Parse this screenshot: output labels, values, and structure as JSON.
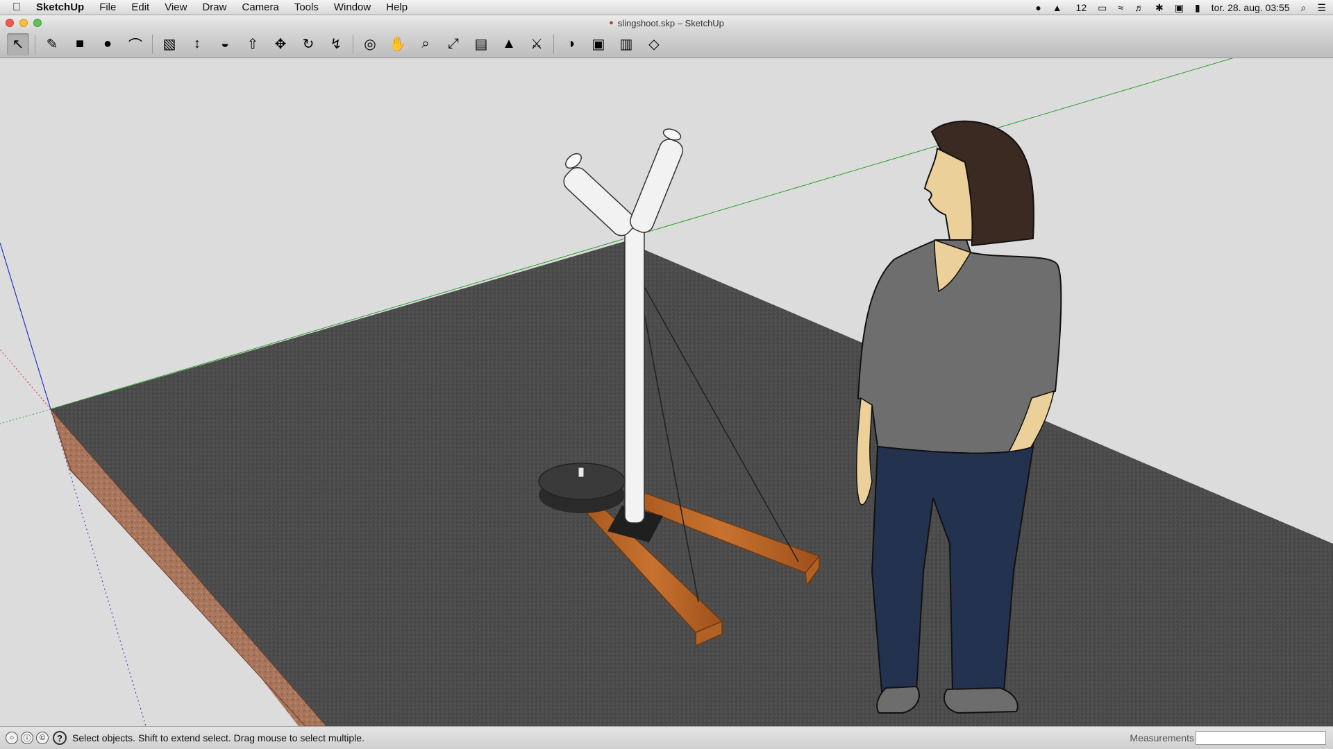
{
  "menubar": {
    "app_name": "SketchUp",
    "items": [
      "File",
      "Edit",
      "View",
      "Draw",
      "Camera",
      "Tools",
      "Window",
      "Help"
    ],
    "right": {
      "notify_count": "12",
      "datetime": "tor. 28. aug.  03:55"
    }
  },
  "window": {
    "title": "slingshoot.skp – SketchUp"
  },
  "toolbar": {
    "tools": [
      {
        "name": "select-tool",
        "icon": "↖"
      },
      {
        "name": "pencil-tool",
        "icon": "✎"
      },
      {
        "name": "rectangle-tool",
        "icon": "■"
      },
      {
        "name": "circle-tool",
        "icon": "●"
      },
      {
        "name": "arc-tool",
        "icon": "⌒"
      },
      {
        "name": "eraser-tool",
        "icon": "▧"
      },
      {
        "name": "tape-measure-tool",
        "icon": "↕"
      },
      {
        "name": "paint-bucket-tool",
        "icon": "◒"
      },
      {
        "name": "push-pull-tool",
        "icon": "⇧"
      },
      {
        "name": "move-tool",
        "icon": "✥"
      },
      {
        "name": "rotate-tool",
        "icon": "↻"
      },
      {
        "name": "follow-me-tool",
        "icon": "↯"
      },
      {
        "name": "orbit-tool",
        "icon": "◎"
      },
      {
        "name": "pan-tool",
        "icon": "✋"
      },
      {
        "name": "zoom-tool",
        "icon": "⌕"
      },
      {
        "name": "zoom-extents-tool",
        "icon": "⤢"
      },
      {
        "name": "previous-view-tool",
        "icon": "▤"
      },
      {
        "name": "position-camera-tool",
        "icon": "▲"
      },
      {
        "name": "walk-tool",
        "icon": "⚔"
      },
      {
        "name": "get-models-tool",
        "icon": "◑"
      },
      {
        "name": "share-model-tool",
        "icon": "▣"
      },
      {
        "name": "extension-warehouse-tool",
        "icon": "▥"
      },
      {
        "name": "layout-tool",
        "icon": "◇"
      }
    ]
  },
  "statusbar": {
    "status_text": "Select objects. Shift to extend select. Drag mouse to select multiple.",
    "measurements_label": "Measurements",
    "measurements_value": ""
  },
  "colors": {
    "sky": "#dcdcdc",
    "ground": "#4a4a4a",
    "wood": "#b8652a",
    "shirt": "#6e6e6e",
    "jeans": "#23324f",
    "skin": "#ecd09a",
    "hair": "#3a2a22"
  }
}
